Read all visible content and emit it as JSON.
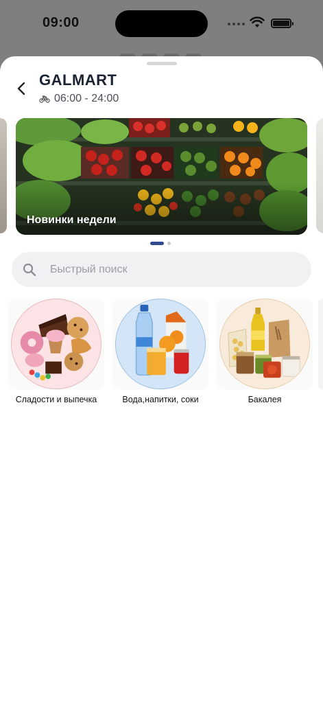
{
  "status_bar": {
    "time": "09:00"
  },
  "store": {
    "name": "GALMART",
    "hours": "06:00 - 24:00"
  },
  "carousel": {
    "slides": [
      {
        "label": "Новинки недели"
      }
    ],
    "active_index": 0,
    "total": 2
  },
  "search": {
    "placeholder": "Быстрый поиск",
    "value": ""
  },
  "categories": [
    {
      "label": "Сладости и выпечка"
    },
    {
      "label": "Вода,напитки, соки"
    },
    {
      "label": "Бакалея"
    }
  ],
  "colors": {
    "accent": "#2f4a8f",
    "title": "#1a2233",
    "search_bg": "#f0f1f3"
  }
}
